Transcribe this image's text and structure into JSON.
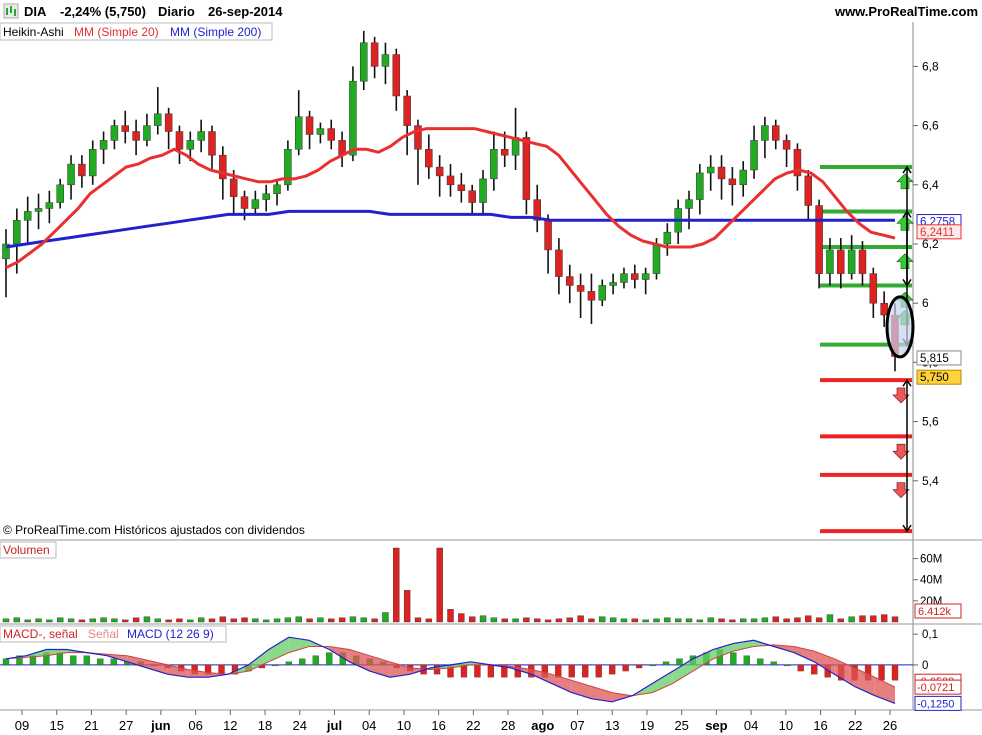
{
  "header": {
    "symbol": "DIA",
    "change": "-2,24% (5,750)",
    "period": "Diario",
    "date": "26-sep-2014",
    "site": "www.ProRealTime.com"
  },
  "legend": {
    "ha": "Heikin-Ashi",
    "ma20": "MM (Simple 20)",
    "ma200": "MM (Simple 200)"
  },
  "copyright": "© ProRealTime.com  Históricos ajustados con dividendos",
  "volume_panel": {
    "title": "Volumen",
    "last_label": "6.412k"
  },
  "macd_panel": {
    "title_a": "MACD-, señal",
    "title_b": "Señal",
    "title_c": "MACD (12 26 9)"
  },
  "colors": {
    "up": "#22aa22",
    "down": "#dd2222",
    "ma20": "#e83030",
    "ma200": "#2222cc",
    "grid": "#cccccc"
  },
  "chart_data": {
    "type": "candlestick",
    "price_axis": {
      "min": 5.2,
      "max": 6.95,
      "ticks": [
        "6,8",
        "6,6",
        "6,4",
        "6,2",
        "6",
        "5,8",
        "5,6",
        "5,4"
      ]
    },
    "price_labels": [
      {
        "text": "6,2758",
        "value": 6.2758,
        "style": "ma200"
      },
      {
        "text": "6,2411",
        "value": 6.2411,
        "style": "ma20"
      },
      {
        "text": "5,815",
        "value": 5.815,
        "style": "plain"
      },
      {
        "text": "5,750",
        "value": 5.75,
        "style": "last"
      }
    ],
    "x_ticks": [
      "09",
      "15",
      "21",
      "27",
      "jun",
      "06",
      "12",
      "18",
      "24",
      "jul",
      "04",
      "10",
      "16",
      "22",
      "28",
      "ago",
      "07",
      "13",
      "19",
      "25",
      "sep",
      "04",
      "10",
      "16",
      "22",
      "26"
    ],
    "candles": [
      [
        6.15,
        6.25,
        6.02,
        6.2
      ],
      [
        6.2,
        6.32,
        6.1,
        6.28
      ],
      [
        6.28,
        6.36,
        6.2,
        6.31
      ],
      [
        6.31,
        6.37,
        6.25,
        6.32
      ],
      [
        6.32,
        6.38,
        6.27,
        6.34
      ],
      [
        6.34,
        6.42,
        6.32,
        6.4
      ],
      [
        6.4,
        6.5,
        6.35,
        6.47
      ],
      [
        6.47,
        6.5,
        6.39,
        6.43
      ],
      [
        6.43,
        6.55,
        6.4,
        6.52
      ],
      [
        6.52,
        6.58,
        6.47,
        6.55
      ],
      [
        6.55,
        6.62,
        6.52,
        6.6
      ],
      [
        6.6,
        6.65,
        6.54,
        6.58
      ],
      [
        6.58,
        6.62,
        6.5,
        6.55
      ],
      [
        6.55,
        6.64,
        6.53,
        6.6
      ],
      [
        6.6,
        6.73,
        6.57,
        6.64
      ],
      [
        6.64,
        6.66,
        6.52,
        6.58
      ],
      [
        6.58,
        6.6,
        6.47,
        6.52
      ],
      [
        6.52,
        6.58,
        6.48,
        6.55
      ],
      [
        6.55,
        6.62,
        6.51,
        6.58
      ],
      [
        6.58,
        6.6,
        6.45,
        6.5
      ],
      [
        6.5,
        6.53,
        6.35,
        6.42
      ],
      [
        6.42,
        6.45,
        6.3,
        6.36
      ],
      [
        6.36,
        6.38,
        6.28,
        6.32
      ],
      [
        6.32,
        6.38,
        6.3,
        6.35
      ],
      [
        6.35,
        6.4,
        6.31,
        6.37
      ],
      [
        6.37,
        6.42,
        6.33,
        6.4
      ],
      [
        6.4,
        6.55,
        6.38,
        6.52
      ],
      [
        6.52,
        6.72,
        6.5,
        6.63
      ],
      [
        6.63,
        6.65,
        6.52,
        6.57
      ],
      [
        6.57,
        6.61,
        6.54,
        6.59
      ],
      [
        6.59,
        6.62,
        6.52,
        6.55
      ],
      [
        6.55,
        6.58,
        6.46,
        6.5
      ],
      [
        6.5,
        6.8,
        6.48,
        6.75
      ],
      [
        6.75,
        6.92,
        6.72,
        6.88
      ],
      [
        6.88,
        6.9,
        6.76,
        6.8
      ],
      [
        6.8,
        6.88,
        6.74,
        6.84
      ],
      [
        6.84,
        6.86,
        6.65,
        6.7
      ],
      [
        6.7,
        6.72,
        6.5,
        6.6
      ],
      [
        6.6,
        6.62,
        6.4,
        6.52
      ],
      [
        6.52,
        6.57,
        6.42,
        6.46
      ],
      [
        6.46,
        6.5,
        6.36,
        6.43
      ],
      [
        6.43,
        6.47,
        6.36,
        6.4
      ],
      [
        6.4,
        6.44,
        6.34,
        6.38
      ],
      [
        6.38,
        6.4,
        6.3,
        6.34
      ],
      [
        6.34,
        6.45,
        6.3,
        6.42
      ],
      [
        6.42,
        6.58,
        6.38,
        6.52
      ],
      [
        6.52,
        6.58,
        6.46,
        6.5
      ],
      [
        6.5,
        6.66,
        6.45,
        6.56
      ],
      [
        6.56,
        6.58,
        6.3,
        6.35
      ],
      [
        6.35,
        6.4,
        6.24,
        6.28
      ],
      [
        6.28,
        6.3,
        6.1,
        6.18
      ],
      [
        6.18,
        6.22,
        6.03,
        6.09
      ],
      [
        6.09,
        6.13,
        6.0,
        6.06
      ],
      [
        6.06,
        6.1,
        5.95,
        6.04
      ],
      [
        6.04,
        6.1,
        5.93,
        6.01
      ],
      [
        6.01,
        6.08,
        5.99,
        6.06
      ],
      [
        6.06,
        6.1,
        6.03,
        6.07
      ],
      [
        6.07,
        6.12,
        6.05,
        6.1
      ],
      [
        6.1,
        6.13,
        6.05,
        6.08
      ],
      [
        6.08,
        6.12,
        6.03,
        6.1
      ],
      [
        6.1,
        6.22,
        6.08,
        6.2
      ],
      [
        6.2,
        6.27,
        6.16,
        6.24
      ],
      [
        6.24,
        6.35,
        6.2,
        6.32
      ],
      [
        6.32,
        6.38,
        6.25,
        6.35
      ],
      [
        6.35,
        6.47,
        6.3,
        6.44
      ],
      [
        6.44,
        6.5,
        6.38,
        6.46
      ],
      [
        6.46,
        6.5,
        6.35,
        6.42
      ],
      [
        6.42,
        6.46,
        6.33,
        6.4
      ],
      [
        6.4,
        6.48,
        6.36,
        6.45
      ],
      [
        6.45,
        6.6,
        6.42,
        6.55
      ],
      [
        6.55,
        6.63,
        6.49,
        6.6
      ],
      [
        6.6,
        6.62,
        6.52,
        6.55
      ],
      [
        6.55,
        6.57,
        6.46,
        6.52
      ],
      [
        6.52,
        6.54,
        6.38,
        6.43
      ],
      [
        6.43,
        6.45,
        6.28,
        6.33
      ],
      [
        6.33,
        6.35,
        6.05,
        6.1
      ],
      [
        6.1,
        6.22,
        6.06,
        6.18
      ],
      [
        6.18,
        6.22,
        6.05,
        6.1
      ],
      [
        6.1,
        6.23,
        6.08,
        6.18
      ],
      [
        6.18,
        6.21,
        6.06,
        6.1
      ],
      [
        6.1,
        6.12,
        5.95,
        6.0
      ],
      [
        6.0,
        6.04,
        5.92,
        5.96
      ],
      [
        5.96,
        6.0,
        5.77,
        5.82
      ]
    ],
    "ma20": [
      6.12,
      6.14,
      6.17,
      6.2,
      6.24,
      6.28,
      6.32,
      6.37,
      6.4,
      6.43,
      6.46,
      6.47,
      6.49,
      6.5,
      6.52,
      6.5,
      6.47,
      6.45,
      6.44,
      6.43,
      6.42,
      6.41,
      6.41,
      6.42,
      6.42,
      6.43,
      6.45,
      6.48,
      6.5,
      6.52,
      6.52,
      6.51,
      6.53,
      6.56,
      6.58,
      6.59,
      6.59,
      6.59,
      6.59,
      6.59,
      6.58,
      6.57,
      6.56,
      6.55,
      6.54,
      6.53,
      6.5,
      6.45,
      6.4,
      6.35,
      6.3,
      6.26,
      6.23,
      6.21,
      6.2,
      6.19,
      6.19,
      6.19,
      6.2,
      6.22,
      6.26,
      6.3,
      6.34,
      6.38,
      6.42,
      6.44,
      6.45,
      6.44,
      6.41,
      6.36,
      6.31,
      6.27,
      6.24,
      6.23,
      6.22
    ],
    "ma200": [
      6.19,
      6.2,
      6.21,
      6.22,
      6.23,
      6.24,
      6.25,
      6.26,
      6.27,
      6.28,
      6.29,
      6.3,
      6.3,
      6.3,
      6.31,
      6.31,
      6.31,
      6.31,
      6.31,
      6.3,
      6.3,
      6.3,
      6.3,
      6.3,
      6.3,
      6.29,
      6.29,
      6.28,
      6.28,
      6.28,
      6.28,
      6.28,
      6.28,
      6.28,
      6.28,
      6.28,
      6.28,
      6.28,
      6.28,
      6.28,
      6.28,
      6.28,
      6.28,
      6.28,
      6.28
    ],
    "levels_green": [
      6.46,
      6.31,
      6.19,
      6.06,
      5.86
    ],
    "levels_red": [
      5.74,
      5.55,
      5.42,
      5.23
    ],
    "volume": {
      "axis_ticks": [
        "60M",
        "40M",
        "20M"
      ],
      "max": 70,
      "values": [
        3,
        4,
        2,
        3,
        2,
        4,
        3,
        2,
        3,
        4,
        3,
        2,
        4,
        5,
        3,
        2,
        3,
        2,
        4,
        3,
        5,
        3,
        4,
        3,
        2,
        3,
        4,
        5,
        3,
        4,
        3,
        4,
        5,
        4,
        3,
        9,
        70,
        30,
        4,
        3,
        70,
        12,
        8,
        5,
        6,
        4,
        3,
        3,
        4,
        3,
        2,
        3,
        4,
        6,
        3,
        5,
        4,
        3,
        3,
        2,
        3,
        4,
        3,
        3,
        2,
        4,
        3,
        2,
        3,
        3,
        4,
        5,
        3,
        4,
        6,
        4,
        7,
        3,
        5,
        6,
        6,
        7,
        5
      ]
    },
    "macd": {
      "axis_ticks": [
        "0,1",
        "0"
      ],
      "range": [
        -0.14,
        0.12
      ],
      "value_labels": [
        {
          "text": "-0,0529",
          "value": -0.0529
        },
        {
          "text": "-0,0721",
          "value": -0.0721
        },
        {
          "text": "-0,1250",
          "value": -0.125
        }
      ],
      "hist": [
        0.02,
        0.03,
        0.03,
        0.04,
        0.04,
        0.03,
        0.03,
        0.02,
        0.02,
        0.01,
        0.01,
        0.0,
        -0.01,
        -0.02,
        -0.03,
        -0.03,
        -0.03,
        -0.03,
        -0.02,
        -0.01,
        0.0,
        0.01,
        0.02,
        0.03,
        0.04,
        0.04,
        0.03,
        0.02,
        0.01,
        -0.01,
        -0.02,
        -0.03,
        -0.03,
        -0.04,
        -0.04,
        -0.04,
        -0.04,
        -0.04,
        -0.04,
        -0.04,
        -0.04,
        -0.04,
        -0.04,
        -0.04,
        -0.04,
        -0.03,
        -0.02,
        -0.01,
        0.0,
        0.01,
        0.02,
        0.03,
        0.04,
        0.05,
        0.04,
        0.03,
        0.02,
        0.01,
        0.0,
        -0.02,
        -0.03,
        -0.04,
        -0.05,
        -0.05,
        -0.05,
        -0.05,
        -0.05
      ],
      "macd": [
        0.02,
        0.03,
        0.05,
        0.05,
        0.04,
        0.03,
        0.01,
        -0.01,
        -0.03,
        -0.04,
        -0.04,
        -0.03,
        0.0,
        0.05,
        0.09,
        0.08,
        0.05,
        0.01,
        -0.02,
        -0.04,
        -0.03,
        -0.01,
        0.0,
        0.01,
        0.0,
        -0.01,
        -0.03,
        -0.06,
        -0.09,
        -0.11,
        -0.12,
        -0.1,
        -0.06,
        -0.02,
        0.02,
        0.05,
        0.07,
        0.08,
        0.06,
        0.04,
        0.01,
        -0.03,
        -0.07,
        -0.1,
        -0.125
      ],
      "signal": [
        0.02,
        0.025,
        0.03,
        0.04,
        0.04,
        0.035,
        0.03,
        0.015,
        0.0,
        -0.015,
        -0.025,
        -0.03,
        -0.02,
        0.01,
        0.04,
        0.06,
        0.06,
        0.05,
        0.03,
        0.01,
        -0.01,
        -0.015,
        -0.01,
        0.0,
        0.0,
        -0.005,
        -0.015,
        -0.03,
        -0.05,
        -0.07,
        -0.09,
        -0.1,
        -0.09,
        -0.06,
        -0.02,
        0.02,
        0.045,
        0.06,
        0.065,
        0.06,
        0.045,
        0.02,
        -0.01,
        -0.04,
        -0.0721
      ]
    }
  }
}
